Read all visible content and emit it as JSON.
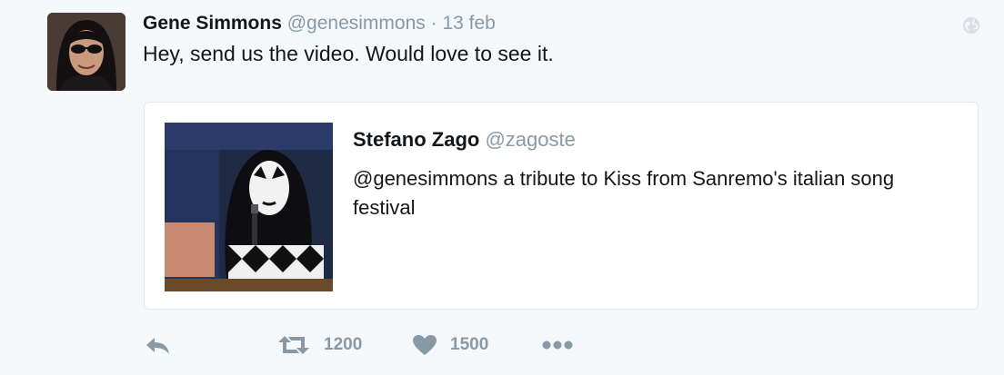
{
  "tweet": {
    "author_name": "Gene Simmons",
    "author_handle": "@genesimmons",
    "separator": "·",
    "timestamp": "13 feb",
    "text": "Hey, send us the video. Would love to see it.",
    "avatar_icon": "avatar-photo",
    "globe_icon": "globe-icon"
  },
  "quoted": {
    "author_name": "Stefano Zago",
    "author_handle": "@zagoste",
    "text": "@genesimmons a tribute to Kiss from  Sanremo's italian song festival",
    "image_icon": "quoted-photo"
  },
  "actions": {
    "retweet_count": "1200",
    "like_count": "1500"
  },
  "colors": {
    "background": "#f5f8fa",
    "muted": "#8899a6",
    "text": "#14171a",
    "border": "#e1e8ed"
  }
}
